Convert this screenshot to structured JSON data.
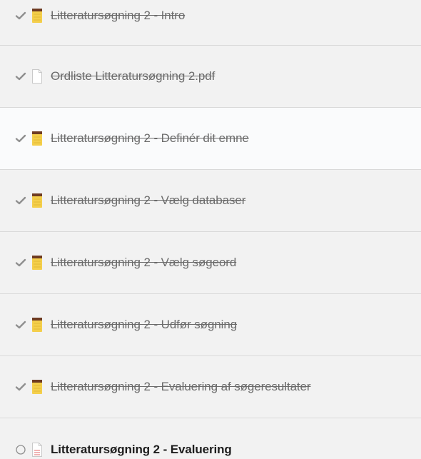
{
  "lessons": [
    {
      "title": "Litteratursøgning 2 - Intro",
      "status": "completed",
      "icon": "notebook-icon"
    },
    {
      "title": "Ordliste Litteratursøgning 2.pdf",
      "status": "completed",
      "icon": "pdf-file-icon"
    },
    {
      "title": "Litteratursøgning 2 - Definér dit emne",
      "status": "completed",
      "icon": "notebook-icon"
    },
    {
      "title": "Litteratursøgning 2 - Vælg databaser",
      "status": "completed",
      "icon": "notebook-icon"
    },
    {
      "title": "Litteratursøgning 2 - Vælg søgeord",
      "status": "completed",
      "icon": "notebook-icon"
    },
    {
      "title": "Litteratursøgning 2 - Udfør søgning",
      "status": "completed",
      "icon": "notebook-icon"
    },
    {
      "title": "Litteratursøgning 2 - Evaluering af søgeresultater",
      "status": "completed",
      "icon": "notebook-icon"
    },
    {
      "title": "Litteratursøgning 2 - Evaluering",
      "status": "not-started",
      "icon": "quiz-file-icon"
    }
  ],
  "colors": {
    "check": "#8f8f8f",
    "notebook_spine": "#6e3b22",
    "notebook_body": "#f4cf4c",
    "text_completed": "#6b6b6b",
    "text_current": "#1e1e1e"
  }
}
